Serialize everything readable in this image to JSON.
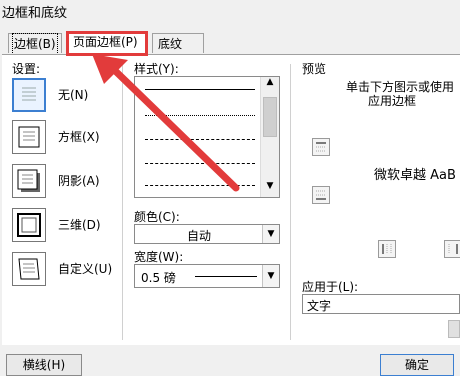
{
  "window": {
    "title": "边框和底纹"
  },
  "tabs": [
    {
      "label": "边框(B)"
    },
    {
      "label": "页面边框(P)"
    },
    {
      "label": "底纹(S)"
    }
  ],
  "settings": {
    "header": "设置:",
    "items": [
      {
        "label": "无(N)"
      },
      {
        "label": "方框(X)"
      },
      {
        "label": "阴影(A)"
      },
      {
        "label": "三维(D)"
      },
      {
        "label": "自定义(U)"
      }
    ]
  },
  "style": {
    "header": "样式(Y):",
    "lines": [
      "solid",
      "dotted-fine",
      "dashed-fine",
      "dashed",
      "dash-long"
    ]
  },
  "color": {
    "label": "颜色(C):",
    "value": "自动"
  },
  "width": {
    "label": "宽度(W):",
    "value": "0.5 磅"
  },
  "preview": {
    "header": "预览",
    "hint": "单击下方图示或使用",
    "hint2": "应用边框",
    "sample_text": "微软卓越 AaB"
  },
  "apply_to": {
    "label": "应用于(L):",
    "value": "文字"
  },
  "footer": {
    "left_button": "横线(H)",
    "ok_button": "确定"
  },
  "annotation": {
    "color": "#e23b3b"
  }
}
